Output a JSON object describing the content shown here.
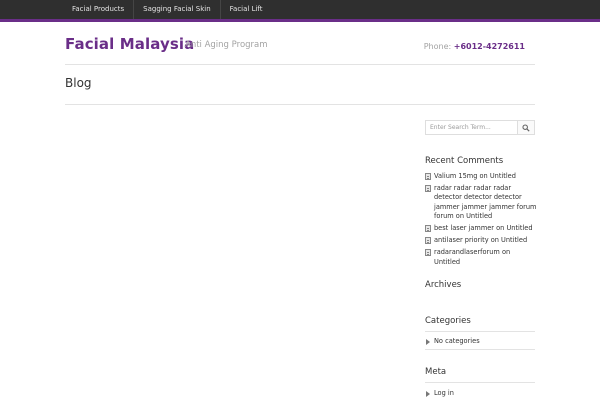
{
  "nav": {
    "items": [
      {
        "label": "Facial Products"
      },
      {
        "label": "Sagging Facial Skin"
      },
      {
        "label": "Facial Lift"
      }
    ]
  },
  "header": {
    "site_title": "Facial Malaysia",
    "tagline": "Anti Aging Program",
    "phone_label": "Phone:",
    "phone_number": "+6012-4272611"
  },
  "main": {
    "page_title": "Blog"
  },
  "sidebar": {
    "search": {
      "placeholder": "Enter Search Term..."
    },
    "recent_comments": {
      "title": "Recent Comments",
      "on_text": "on",
      "items": [
        {
          "author": "Valium 15mg",
          "post": "Untitled"
        },
        {
          "author": "radar radar radar radar detector detector detector jammer jammer jammer forum forum",
          "post": "Untitled"
        },
        {
          "author": "best laser jammer",
          "post": "Untitled"
        },
        {
          "author": "antilaser priority",
          "post": "Untitled"
        },
        {
          "author": "radarandlaserforum",
          "post": "Untitled"
        }
      ]
    },
    "archives": {
      "title": "Archives"
    },
    "categories": {
      "title": "Categories",
      "empty_text": "No categories"
    },
    "meta": {
      "title": "Meta",
      "login_label": "Log in"
    }
  },
  "colors": {
    "accent": "#6a2e88",
    "topbar": "#2f2f2f"
  }
}
